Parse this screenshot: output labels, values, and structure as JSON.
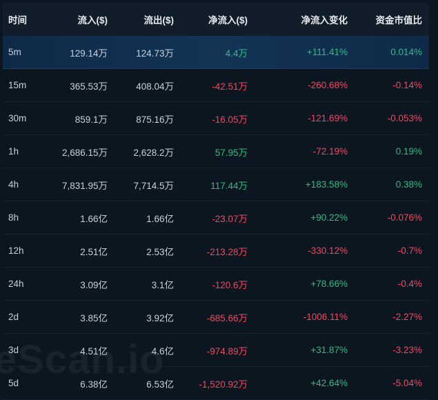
{
  "table": {
    "headers": [
      "时间",
      "流入($)",
      "流出($)",
      "净流入($)",
      "净流入变化",
      "资金市值比"
    ],
    "rows": [
      {
        "tf": "5m",
        "inflow": "129.14万",
        "outflow": "124.73万",
        "net": "4.4万",
        "net_dir": "pos",
        "change": "+111.41%",
        "change_dir": "pos",
        "ratio": "0.014%",
        "ratio_dir": "pos"
      },
      {
        "tf": "15m",
        "inflow": "365.53万",
        "outflow": "408.04万",
        "net": "-42.51万",
        "net_dir": "neg",
        "change": "-260.68%",
        "change_dir": "neg",
        "ratio": "-0.14%",
        "ratio_dir": "neg"
      },
      {
        "tf": "30m",
        "inflow": "859.1万",
        "outflow": "875.16万",
        "net": "-16.05万",
        "net_dir": "neg",
        "change": "-121.69%",
        "change_dir": "neg",
        "ratio": "-0.053%",
        "ratio_dir": "neg"
      },
      {
        "tf": "1h",
        "inflow": "2,686.15万",
        "outflow": "2,628.2万",
        "net": "57.95万",
        "net_dir": "pos",
        "change": "-72.19%",
        "change_dir": "neg",
        "ratio": "0.19%",
        "ratio_dir": "pos"
      },
      {
        "tf": "4h",
        "inflow": "7,831.95万",
        "outflow": "7,714.5万",
        "net": "117.44万",
        "net_dir": "pos",
        "change": "+183.58%",
        "change_dir": "pos",
        "ratio": "0.38%",
        "ratio_dir": "pos"
      },
      {
        "tf": "8h",
        "inflow": "1.66亿",
        "outflow": "1.66亿",
        "net": "-23.07万",
        "net_dir": "neg",
        "change": "+90.22%",
        "change_dir": "pos",
        "ratio": "-0.076%",
        "ratio_dir": "neg"
      },
      {
        "tf": "12h",
        "inflow": "2.51亿",
        "outflow": "2.53亿",
        "net": "-213.28万",
        "net_dir": "neg",
        "change": "-330.12%",
        "change_dir": "neg",
        "ratio": "-0.7%",
        "ratio_dir": "neg"
      },
      {
        "tf": "24h",
        "inflow": "3.09亿",
        "outflow": "3.1亿",
        "net": "-120.6万",
        "net_dir": "neg",
        "change": "+78.66%",
        "change_dir": "pos",
        "ratio": "-0.4%",
        "ratio_dir": "neg"
      },
      {
        "tf": "2d",
        "inflow": "3.85亿",
        "outflow": "3.92亿",
        "net": "-685.66万",
        "net_dir": "neg",
        "change": "-1006.11%",
        "change_dir": "neg",
        "ratio": "-2.27%",
        "ratio_dir": "neg"
      },
      {
        "tf": "3d",
        "inflow": "4.51亿",
        "outflow": "4.6亿",
        "net": "-974.89万",
        "net_dir": "neg",
        "change": "+31.87%",
        "change_dir": "pos",
        "ratio": "-3.23%",
        "ratio_dir": "neg"
      },
      {
        "tf": "5d",
        "inflow": "6.38亿",
        "outflow": "6.53亿",
        "net": "-1,520.92万",
        "net_dir": "neg",
        "change": "+42.64%",
        "change_dir": "pos",
        "ratio": "-5.04%",
        "ratio_dir": "neg"
      }
    ]
  },
  "watermark": "eScan.io",
  "colors": {
    "positive": "#2ebd85",
    "negative": "#f6465d",
    "background": "#0b1620",
    "header_bg": "#111d29",
    "highlight_row": "#133455"
  }
}
